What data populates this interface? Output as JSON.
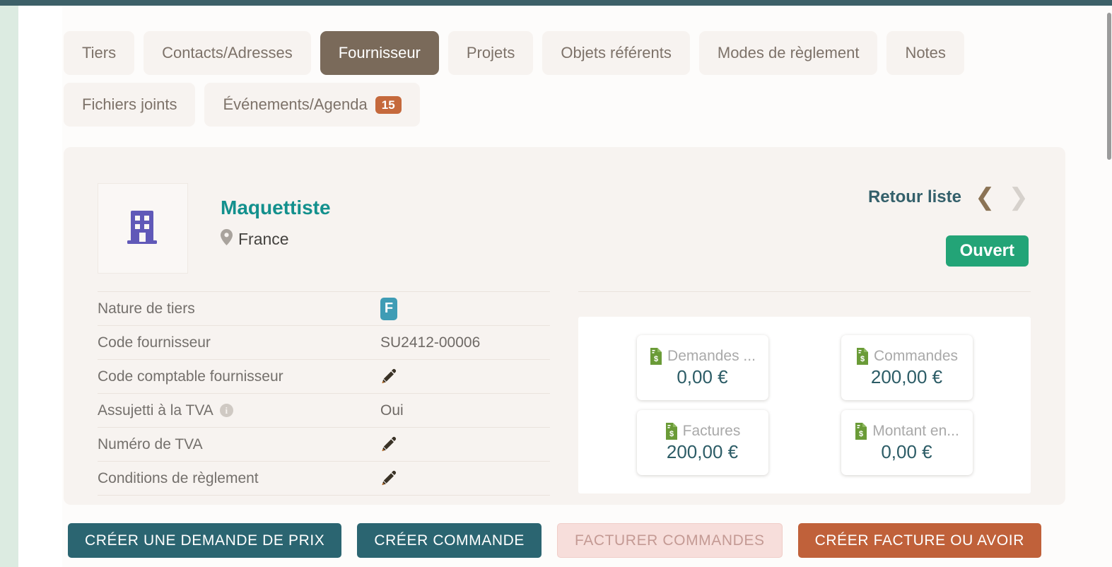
{
  "theme": {
    "topbar_color": "#3d6068",
    "sidebar_color": "#dcebe1",
    "card_bg": "#f7f3f0",
    "tab_active_bg": "#7a6a5a",
    "accent_teal": "#13908d",
    "status_green": "#23a477",
    "badge_orange": "#c5693c",
    "primary_button": "#2b6571",
    "danger_button": "#c0613a"
  },
  "tabs": [
    {
      "label": "Tiers",
      "active": false,
      "badge": ""
    },
    {
      "label": "Contacts/Adresses",
      "active": false,
      "badge": ""
    },
    {
      "label": "Fournisseur",
      "active": true,
      "badge": ""
    },
    {
      "label": "Projets",
      "active": false,
      "badge": ""
    },
    {
      "label": "Objets référents",
      "active": false,
      "badge": ""
    },
    {
      "label": "Modes de règlement",
      "active": false,
      "badge": ""
    },
    {
      "label": "Notes",
      "active": false,
      "badge": ""
    },
    {
      "label": "Fichiers joints",
      "active": false,
      "badge": ""
    },
    {
      "label": "Événements/Agenda",
      "active": false,
      "badge": "15"
    }
  ],
  "record": {
    "name": "Maquettiste",
    "country": "France",
    "logo_icon": "building-icon",
    "location_icon": "map-pin-icon",
    "status": "Ouvert",
    "back_to_list": "Retour liste",
    "prev_icon": "chevron-left-icon",
    "next_icon": "chevron-right-icon"
  },
  "fields": [
    {
      "label": "Nature de tiers",
      "value": "",
      "badge": "F",
      "edit": false,
      "info": false
    },
    {
      "label": "Code fournisseur",
      "value": "SU2412-00006",
      "badge": "",
      "edit": false,
      "info": false
    },
    {
      "label": "Code comptable fournisseur",
      "value": "",
      "badge": "",
      "edit": true,
      "info": false
    },
    {
      "label": "Assujetti à la TVA",
      "value": "Oui",
      "badge": "",
      "edit": false,
      "info": true
    },
    {
      "label": "Numéro de TVA",
      "value": "",
      "badge": "",
      "edit": true,
      "info": false
    },
    {
      "label": "Conditions de règlement",
      "value": "",
      "badge": "",
      "edit": true,
      "info": false
    }
  ],
  "stats": [
    {
      "label": "Demandes ...",
      "value": "0,00 €",
      "icon": "invoice-icon"
    },
    {
      "label": "Commandes",
      "value": "200,00 €",
      "icon": "invoice-icon"
    },
    {
      "label": "Factures",
      "value": "200,00 €",
      "icon": "invoice-icon"
    },
    {
      "label": "Montant en...",
      "value": "0,00 €",
      "icon": "invoice-icon"
    }
  ],
  "actions": [
    {
      "label": "CRÉER UNE DEMANDE DE PRIX",
      "style": "teal",
      "disabled": false
    },
    {
      "label": "CRÉER COMMANDE",
      "style": "teal",
      "disabled": false
    },
    {
      "label": "FACTURER COMMANDES",
      "style": "disabled",
      "disabled": true
    },
    {
      "label": "CRÉER FACTURE OU AVOIR",
      "style": "orange",
      "disabled": false
    }
  ]
}
